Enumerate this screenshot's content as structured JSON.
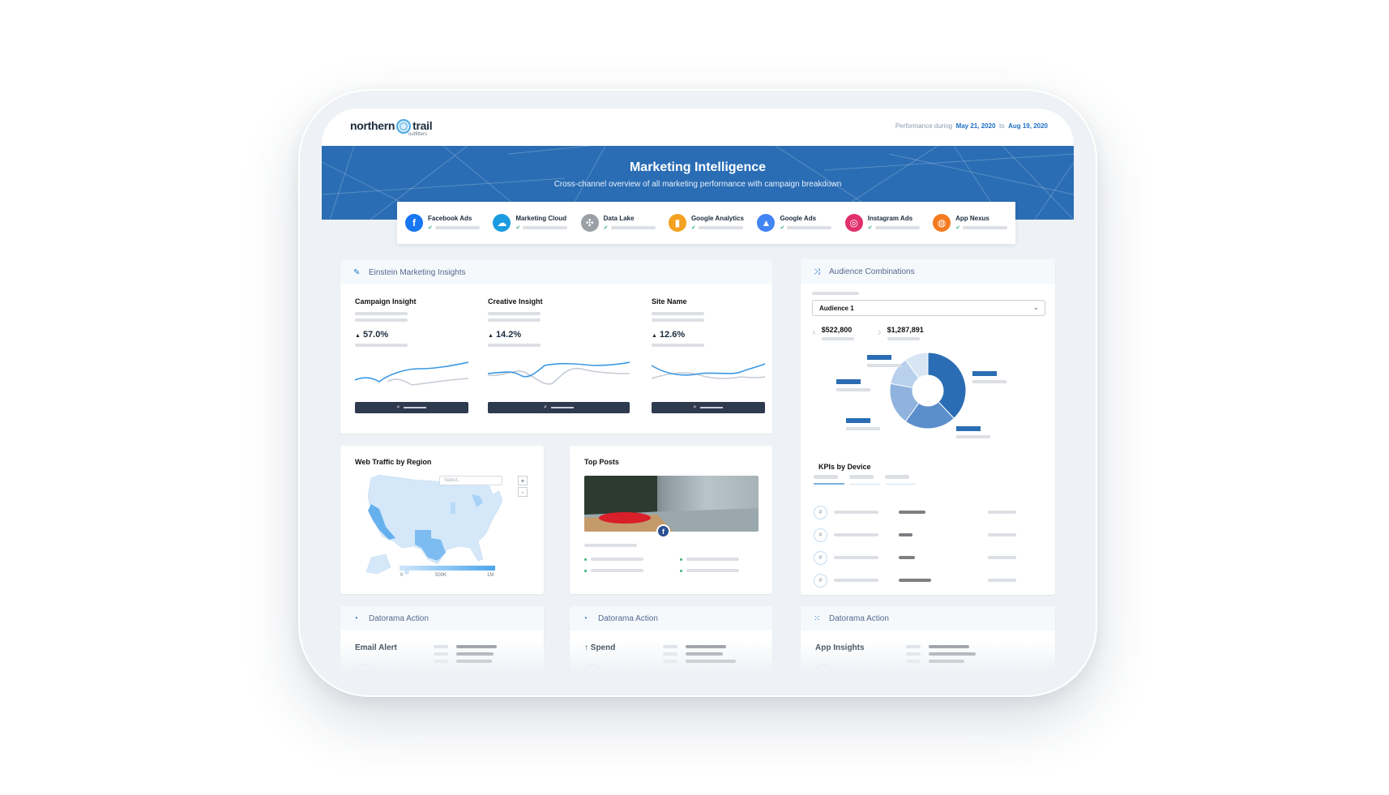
{
  "brand": {
    "logo_word1": "northern",
    "logo_word2": "trail",
    "logo_sub": "outfitters"
  },
  "performance": {
    "prefix": "Performance during",
    "start_date": "May 21, 2020",
    "joiner": "to",
    "end_date": "Aug 19, 2020"
  },
  "banner": {
    "title": "Marketing Intelligence",
    "subtitle": "Cross-channel overview of all marketing performance with campaign breakdown",
    "color": "#2a6db4"
  },
  "connectors": [
    {
      "label": "Facebook Ads",
      "icon": "facebook-icon",
      "color": "#1877f2",
      "glyph": "f",
      "status": "connected"
    },
    {
      "label": "Marketing Cloud",
      "icon": "salesforce-cloud-icon",
      "color": "#1c9ce0",
      "glyph": "☁",
      "status": "connected"
    },
    {
      "label": "Data Lake",
      "icon": "data-lake-icon",
      "color": "#9aa0a6",
      "glyph": "✣",
      "status": "connected"
    },
    {
      "label": "Google Analytics",
      "icon": "google-analytics-icon",
      "color": "#f4a020",
      "glyph": "▮",
      "status": "connected"
    },
    {
      "label": "Google Ads",
      "icon": "google-ads-icon",
      "color": "#4285f4",
      "glyph": "▲",
      "status": "connected"
    },
    {
      "label": "Instagram Ads",
      "icon": "instagram-icon",
      "color": "#e1306c",
      "glyph": "◎",
      "status": "connected"
    },
    {
      "label": "App Nexus",
      "icon": "app-nexus-icon",
      "color": "#f47b20",
      "glyph": "◍",
      "status": "connected"
    }
  ],
  "einstein": {
    "title": "Einstein Marketing Insights",
    "icon": "einstein-wand-icon",
    "columns": [
      {
        "label": "Campaign Insight",
        "change": "57.0%",
        "direction": "up"
      },
      {
        "label": "Creative Insight",
        "change": "14.2%",
        "direction": "up"
      },
      {
        "label": "Site Name",
        "change": "12.6%",
        "direction": "up"
      }
    ]
  },
  "audience": {
    "title": "Audience Combinations",
    "icon": "shuffle-icon",
    "selected": "Audience 1",
    "metrics": [
      "$522,800",
      "$1,287,891"
    ],
    "donut_segments": [
      0.38,
      0.22,
      0.18,
      0.12,
      0.1
    ],
    "donut_colors": [
      "#2a6db4",
      "#5b8fcb",
      "#8fb3de",
      "#b9d0ec",
      "#d8e5f3"
    ],
    "kpi_title": "KPIs by Device",
    "kpi_rows": 4
  },
  "web_traffic": {
    "title": "Web Traffic by Region",
    "select_placeholder": "Select..",
    "zoom_in": "+",
    "zoom_out": "-",
    "legend_ticks": [
      "0",
      "500K",
      "1M"
    ]
  },
  "top_posts": {
    "title": "Top Posts",
    "badge": "f"
  },
  "actions": [
    {
      "title": "Datorama Action",
      "subtitle": "Email Alert",
      "icon": "datorama-icon"
    },
    {
      "title": "Datorama Action",
      "subtitle": "Spend",
      "icon": "datorama-icon",
      "arrow": "↑"
    },
    {
      "title": "Datorama Action",
      "subtitle": "App Insights",
      "icon": "datorama-grid-icon"
    }
  ]
}
